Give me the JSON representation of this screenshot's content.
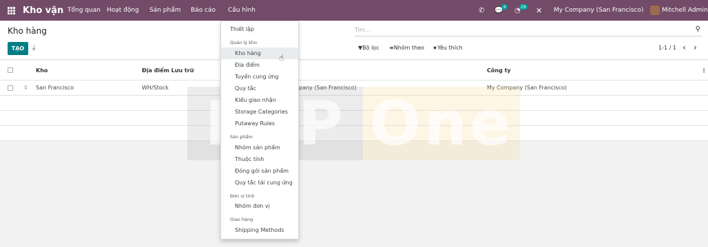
{
  "navbar": {
    "app_name": "Kho vận",
    "menu": [
      "Tổng quan",
      "Hoạt động",
      "Sản phẩm",
      "Báo cáo",
      "Cấu hình"
    ],
    "messages_badge": "4",
    "activities_badge": "29",
    "company": "My Company (San Francisco)",
    "user": "Mitchell Admin"
  },
  "control": {
    "breadcrumb": "Kho hàng",
    "create_label": "TẠO",
    "search_placeholder": "Tìm...",
    "filters_label": "Bộ lọc",
    "group_by_label": "Nhóm theo",
    "favorites_label": "Yêu thích",
    "pager": "1-1 / 1"
  },
  "table": {
    "columns": [
      "Kho",
      "Địa điểm Lưu trữ",
      "Công ty"
    ],
    "rows": [
      {
        "name": "San Francisco",
        "location": "WH/Stock",
        "address": "pany (San Francisco)",
        "company": "My Company (San Francisco)"
      }
    ]
  },
  "watermark": {
    "left": "ERP",
    "right": "One"
  },
  "dropdown": {
    "top_item": "Thiết lập",
    "sections": [
      {
        "header": "Quản lý kho",
        "items": [
          "Kho hàng",
          "Địa điểm",
          "Tuyến cung ứng",
          "Quy tắc",
          "Kiểu giao nhận",
          "Storage Categories",
          "Putaway Rules"
        ]
      },
      {
        "header": "Sản phẩm",
        "items": [
          "Nhóm sản phẩm",
          "Thuộc tính",
          "Đóng gói sản phẩm",
          "Quy tắc tái cung ứng"
        ]
      },
      {
        "header": "Đơn vị tính",
        "items": [
          "Nhóm đơn vị"
        ]
      },
      {
        "header": "Giao hàng",
        "items": [
          "Shipping Methods"
        ]
      }
    ],
    "active_item": "Kho hàng"
  },
  "colors": {
    "navbar": "#714b67",
    "primary": "#017e84",
    "badge": "#00a09d"
  }
}
